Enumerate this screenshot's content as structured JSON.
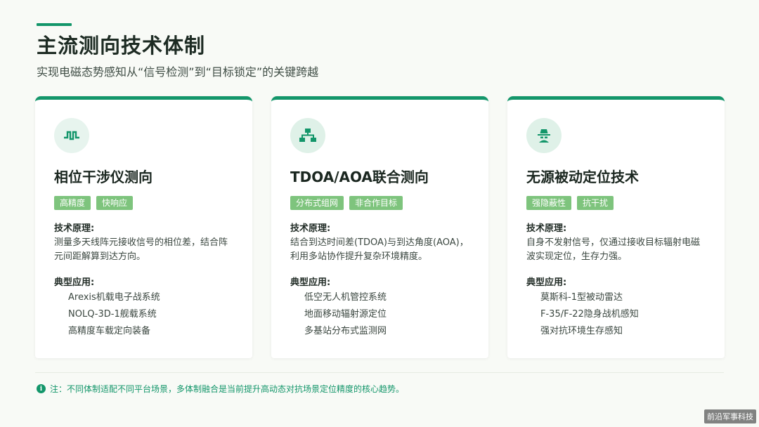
{
  "header": {
    "title": "主流测向技术体制",
    "subtitle": "实现电磁态势感知从“信号检测”到“目标锁定”的关键跨越"
  },
  "cards": [
    {
      "icon": "waveform-icon",
      "title": "相位干涉仪测向",
      "tags": [
        "高精度",
        "快响应"
      ],
      "principle_label": "技术原理:",
      "principle": "测量多天线阵元接收信号的相位差，结合阵元间距解算到达方向。",
      "apps_label": "典型应用:",
      "apps": [
        "Arexis机载电子战系统",
        "NOLQ-3D-1舰载系统",
        "高精度车载定向装备"
      ]
    },
    {
      "icon": "network-icon",
      "title": "TDOA/AOA联合测向",
      "tags": [
        "分布式组网",
        "非合作目标"
      ],
      "principle_label": "技术原理:",
      "principle": "结合到达时间差(TDOA)与到达角度(AOA)，利用多站协作提升复杂环境精度。",
      "apps_label": "典型应用:",
      "apps": [
        "低空无人机管控系统",
        "地面移动辐射源定位",
        "多基站分布式监测网"
      ]
    },
    {
      "icon": "incognito-icon",
      "title": "无源被动定位技术",
      "tags": [
        "强隐蔽性",
        "抗干扰"
      ],
      "principle_label": "技术原理:",
      "principle": "自身不发射信号，仅通过接收目标辐射电磁波实现定位，生存力强。",
      "apps_label": "典型应用:",
      "apps": [
        "莫斯科-1型被动雷达",
        "F-35/F-22隐身战机感知",
        "强对抗环境生存感知"
      ]
    }
  ],
  "footer": {
    "note": "注：不同体制适配不同平台场景，多体制融合是当前提升高动态对抗场景定位精度的核心趋势。",
    "note_icon": "info-icon"
  },
  "watermark": "前沿军事科技",
  "colors": {
    "accent": "#13966a",
    "tag": "#7ec47d"
  }
}
